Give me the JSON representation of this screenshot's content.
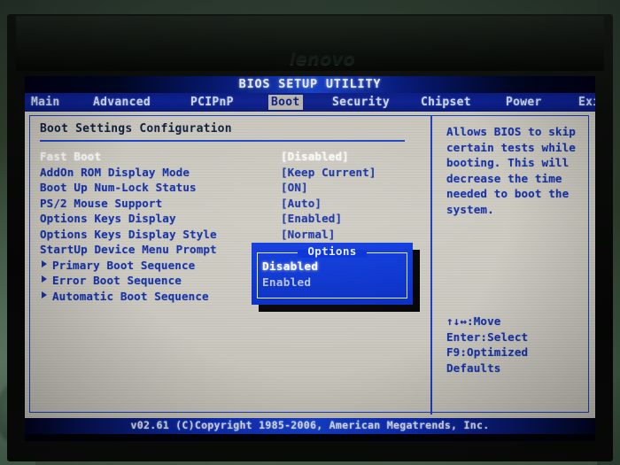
{
  "photo": {
    "monitor_brand": "lenovo"
  },
  "screen": {
    "title": "BIOS SETUP UTILITY",
    "tabs": [
      {
        "label": "Main",
        "active": false
      },
      {
        "label": "Advanced",
        "active": false
      },
      {
        "label": "PCIPnP",
        "active": false
      },
      {
        "label": "Boot",
        "active": true
      },
      {
        "label": "Security",
        "active": false
      },
      {
        "label": "Chipset",
        "active": false
      },
      {
        "label": "Power",
        "active": false
      },
      {
        "label": "Exit",
        "active": false
      }
    ],
    "section_title": "Boot Settings Configuration",
    "settings": [
      {
        "label": "Fast Boot",
        "value": "[Disabled]",
        "state": "dim",
        "submenu": false
      },
      {
        "label": "AddOn ROM Display Mode",
        "value": "[Keep Current]",
        "state": "normal",
        "submenu": false
      },
      {
        "label": "Boot Up Num-Lock Status",
        "value": "[ON]",
        "state": "normal",
        "submenu": false
      },
      {
        "label": "PS/2 Mouse Support",
        "value": "[Auto]",
        "state": "normal",
        "submenu": false
      },
      {
        "label": "Options Keys Display",
        "value": "[Enabled]",
        "state": "normal",
        "submenu": false
      },
      {
        "label": "Options Keys Display Style",
        "value": "[Normal]",
        "state": "normal",
        "submenu": false
      },
      {
        "label": "StartUp Device Menu Prompt",
        "value": "",
        "state": "normal",
        "submenu": false
      },
      {
        "label": "Primary Boot Sequence",
        "value": "",
        "state": "normal",
        "submenu": true
      },
      {
        "label": "Error Boot Sequence",
        "value": "",
        "state": "normal",
        "submenu": true
      },
      {
        "label": "Automatic Boot Sequence",
        "value": "",
        "state": "normal",
        "submenu": true
      }
    ],
    "help": {
      "text": "Allows BIOS to skip\ncertain tests while\nbooting. This will\ndecrease the time\nneeded to boot the\nsystem.",
      "keys": "↑↓↔:Move   Enter:Select\nF9:Optimized Defaults"
    },
    "popup": {
      "title": "Options",
      "items": [
        {
          "label": "Disabled",
          "selected": true
        },
        {
          "label": "Enabled",
          "selected": false
        }
      ]
    },
    "footer": {
      "copyright": "v02.61 (C)Copyright 1985-2006, American Megatrends, Inc."
    }
  }
}
